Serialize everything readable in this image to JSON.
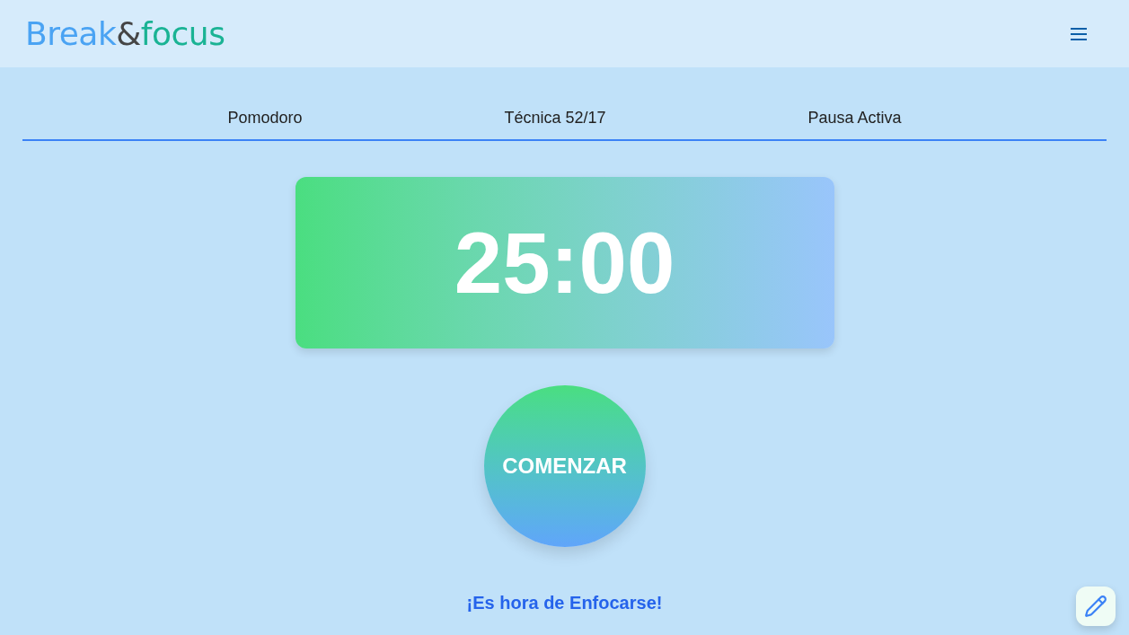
{
  "header": {
    "logo": [
      {
        "text": "Break",
        "color": "#4aa3f3"
      },
      {
        "text": "&",
        "color": "#454545"
      },
      {
        "text": "focus",
        "color": "#1ab394"
      }
    ]
  },
  "tabs": [
    {
      "label": "Pomodoro"
    },
    {
      "label": "Técnica 52/17"
    },
    {
      "label": "Pausa Activa"
    }
  ],
  "timer": {
    "display": "25:00"
  },
  "start_button": {
    "label": "COMENZAR"
  },
  "message": "¡Es hora de Enfocarse!"
}
